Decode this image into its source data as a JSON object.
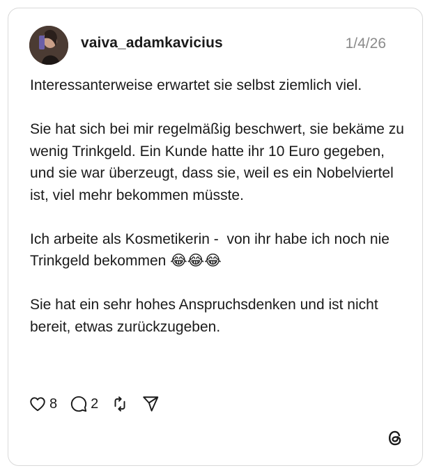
{
  "post": {
    "username": "vaiva_adamkavicius",
    "date": "1/4/26",
    "paragraphs": [
      "Interessanterweise erwartet sie selbst ziemlich viel.",
      "Sie hat sich bei mir regelmäßig beschwert, sie bekäme zu wenig Trinkgeld. Ein Kunde hatte ihr 10 Euro gegeben, und sie war überzeugt, dass sie, weil es ein Nobelviertel ist, viel mehr bekommen müsste.",
      "Ich arbeite als Kosmetikerin -  von ihr habe ich noch nie Trinkgeld bekommen 😂😂😂",
      "Sie hat ein sehr hohes Anspruchsdenken und ist nicht  bereit, etwas zurückzugeben."
    ],
    "likes": "8",
    "replies": "2"
  },
  "icons": {
    "avatar": "user-avatar",
    "like": "heart-icon",
    "reply": "speech-bubble-icon",
    "repost": "repost-icon",
    "share": "send-icon",
    "brand": "threads-logo-icon"
  }
}
